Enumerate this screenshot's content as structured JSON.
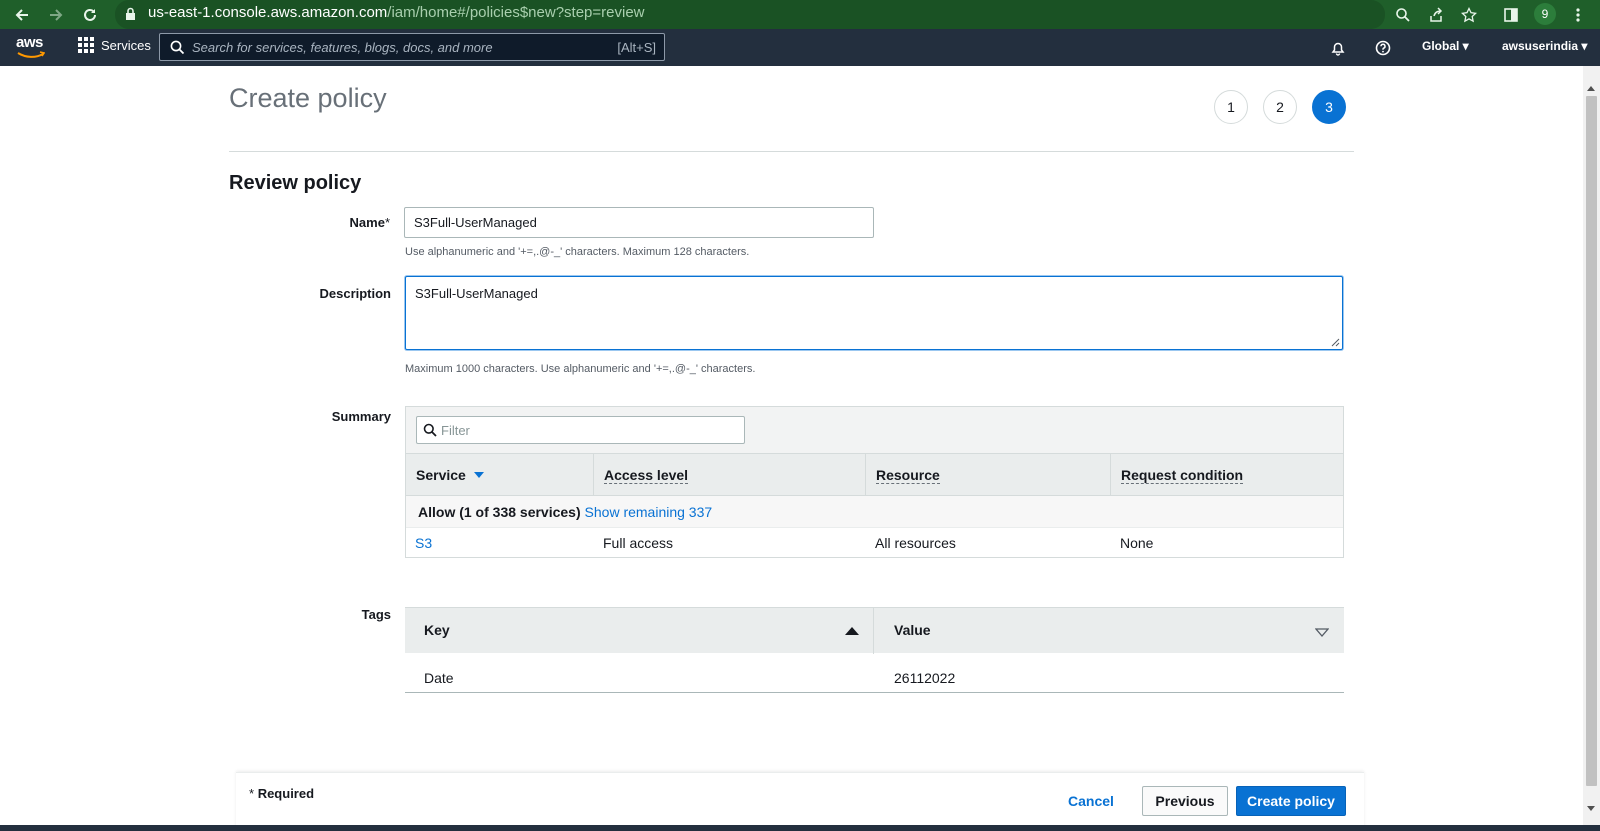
{
  "browser": {
    "url_host": "us-east-1.console.aws.amazon.com",
    "url_path": "/iam/home#/policies$new?step=review",
    "profile_initial": "9"
  },
  "aws_nav": {
    "logo": "aws",
    "services_label": "Services",
    "search_placeholder": "Search for services, features, blogs, docs, and more",
    "search_shortcut": "[Alt+S]",
    "region": "Global",
    "account": "awsuserindia"
  },
  "page": {
    "title": "Create policy",
    "steps": [
      "1",
      "2",
      "3"
    ],
    "active_step": 3,
    "section_title": "Review policy"
  },
  "form": {
    "name_label": "Name",
    "name_required_mark": "*",
    "name_value": "S3Full-UserManaged",
    "name_hint": "Use alphanumeric and '+=,.@-_' characters. Maximum 128 characters.",
    "description_label": "Description",
    "description_value": "S3Full-UserManaged",
    "description_hint": "Maximum 1000 characters. Use alphanumeric and '+=,.@-_' characters.",
    "summary_label": "Summary",
    "tags_label": "Tags"
  },
  "summary": {
    "filter_placeholder": "Filter",
    "columns": [
      "Service",
      "Access level",
      "Resource",
      "Request condition"
    ],
    "allow_text": "Allow (1 of 338 services)",
    "show_remaining": "Show remaining 337",
    "rows": [
      {
        "service": "S3",
        "access": "Full access",
        "resource": "All resources",
        "condition": "None"
      }
    ]
  },
  "tags": {
    "columns": [
      "Key",
      "Value"
    ],
    "rows": [
      {
        "key": "Date",
        "value": "26112022"
      }
    ]
  },
  "footer": {
    "required_mark": "*",
    "required_label": "Required",
    "cancel": "Cancel",
    "previous": "Previous",
    "create": "Create policy"
  },
  "colors": {
    "browser_bar": "#1f5f2a",
    "aws_nav": "#232f3e",
    "primary": "#0972d3"
  }
}
